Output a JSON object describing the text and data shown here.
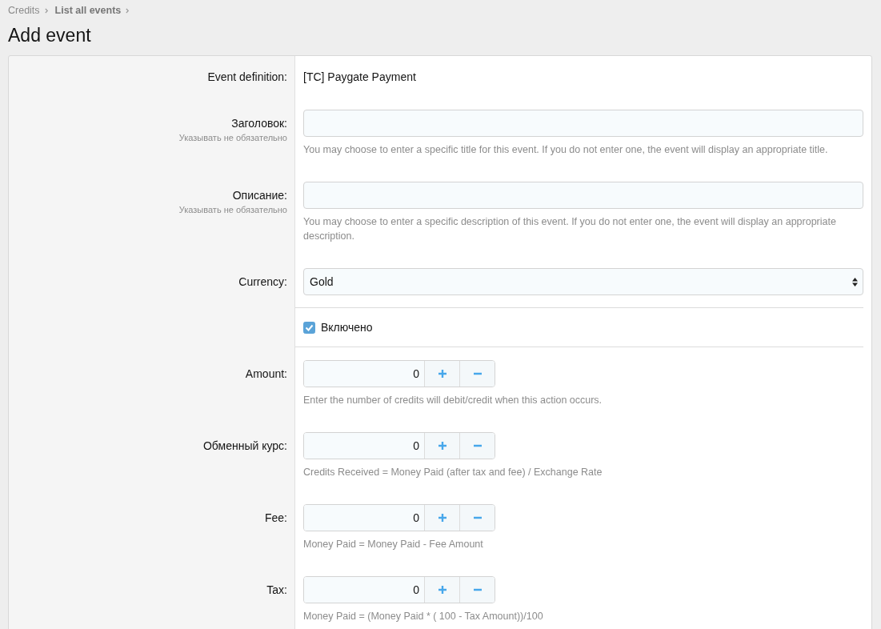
{
  "breadcrumb": [
    {
      "label": "Credits",
      "bold": false
    },
    {
      "label": "List all events",
      "bold": true
    }
  ],
  "title": "Add event",
  "rows": [
    {
      "kind": "text",
      "label": "Event definition:",
      "value": "[TC] Paygate Payment"
    },
    {
      "kind": "text_input",
      "label": "Заголовок:",
      "sublabel": "Указывать не обязательно",
      "hint": "You may choose to enter a specific title for this event. If you do not enter one, the event will display an appropriate title."
    },
    {
      "kind": "text_input",
      "label": "Описание:",
      "sublabel": "Указывать не обязательно",
      "hint": "You may choose to enter a specific description of this event. If you do not enter one, the event will display an appropriate description."
    },
    {
      "kind": "select",
      "label": "Currency:",
      "value": "Gold"
    },
    {
      "kind": "checkbox",
      "text": "Включено",
      "checked": true
    },
    {
      "kind": "number",
      "label": "Amount:",
      "value": "0",
      "hint": "Enter the number of credits will debit/credit when this action occurs."
    },
    {
      "kind": "number",
      "label": "Обменный курс:",
      "value": "0",
      "hint": "Credits Received = Money Paid (after tax and fee) / Exchange Rate"
    },
    {
      "kind": "number",
      "label": "Fee:",
      "value": "0",
      "hint": "Money Paid = Money Paid - Fee Amount"
    },
    {
      "kind": "number",
      "label": "Tax:",
      "value": "0",
      "hint": "Money Paid = (Money Paid * ( 100 - Tax Amount))/100"
    }
  ]
}
